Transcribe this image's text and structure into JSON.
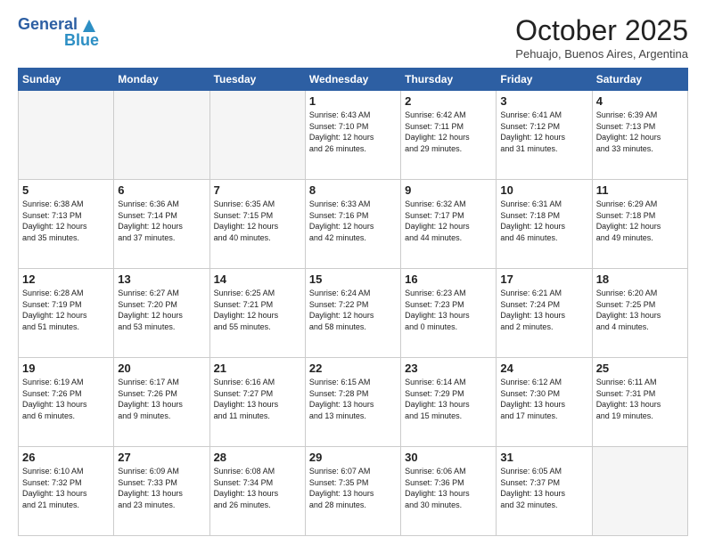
{
  "header": {
    "logo_line1": "General",
    "logo_line2": "Blue",
    "month_title": "October 2025",
    "location": "Pehuajo, Buenos Aires, Argentina"
  },
  "days_of_week": [
    "Sunday",
    "Monday",
    "Tuesday",
    "Wednesday",
    "Thursday",
    "Friday",
    "Saturday"
  ],
  "weeks": [
    [
      {
        "num": "",
        "info": ""
      },
      {
        "num": "",
        "info": ""
      },
      {
        "num": "",
        "info": ""
      },
      {
        "num": "1",
        "info": "Sunrise: 6:43 AM\nSunset: 7:10 PM\nDaylight: 12 hours\nand 26 minutes."
      },
      {
        "num": "2",
        "info": "Sunrise: 6:42 AM\nSunset: 7:11 PM\nDaylight: 12 hours\nand 29 minutes."
      },
      {
        "num": "3",
        "info": "Sunrise: 6:41 AM\nSunset: 7:12 PM\nDaylight: 12 hours\nand 31 minutes."
      },
      {
        "num": "4",
        "info": "Sunrise: 6:39 AM\nSunset: 7:13 PM\nDaylight: 12 hours\nand 33 minutes."
      }
    ],
    [
      {
        "num": "5",
        "info": "Sunrise: 6:38 AM\nSunset: 7:13 PM\nDaylight: 12 hours\nand 35 minutes."
      },
      {
        "num": "6",
        "info": "Sunrise: 6:36 AM\nSunset: 7:14 PM\nDaylight: 12 hours\nand 37 minutes."
      },
      {
        "num": "7",
        "info": "Sunrise: 6:35 AM\nSunset: 7:15 PM\nDaylight: 12 hours\nand 40 minutes."
      },
      {
        "num": "8",
        "info": "Sunrise: 6:33 AM\nSunset: 7:16 PM\nDaylight: 12 hours\nand 42 minutes."
      },
      {
        "num": "9",
        "info": "Sunrise: 6:32 AM\nSunset: 7:17 PM\nDaylight: 12 hours\nand 44 minutes."
      },
      {
        "num": "10",
        "info": "Sunrise: 6:31 AM\nSunset: 7:18 PM\nDaylight: 12 hours\nand 46 minutes."
      },
      {
        "num": "11",
        "info": "Sunrise: 6:29 AM\nSunset: 7:18 PM\nDaylight: 12 hours\nand 49 minutes."
      }
    ],
    [
      {
        "num": "12",
        "info": "Sunrise: 6:28 AM\nSunset: 7:19 PM\nDaylight: 12 hours\nand 51 minutes."
      },
      {
        "num": "13",
        "info": "Sunrise: 6:27 AM\nSunset: 7:20 PM\nDaylight: 12 hours\nand 53 minutes."
      },
      {
        "num": "14",
        "info": "Sunrise: 6:25 AM\nSunset: 7:21 PM\nDaylight: 12 hours\nand 55 minutes."
      },
      {
        "num": "15",
        "info": "Sunrise: 6:24 AM\nSunset: 7:22 PM\nDaylight: 12 hours\nand 58 minutes."
      },
      {
        "num": "16",
        "info": "Sunrise: 6:23 AM\nSunset: 7:23 PM\nDaylight: 13 hours\nand 0 minutes."
      },
      {
        "num": "17",
        "info": "Sunrise: 6:21 AM\nSunset: 7:24 PM\nDaylight: 13 hours\nand 2 minutes."
      },
      {
        "num": "18",
        "info": "Sunrise: 6:20 AM\nSunset: 7:25 PM\nDaylight: 13 hours\nand 4 minutes."
      }
    ],
    [
      {
        "num": "19",
        "info": "Sunrise: 6:19 AM\nSunset: 7:26 PM\nDaylight: 13 hours\nand 6 minutes."
      },
      {
        "num": "20",
        "info": "Sunrise: 6:17 AM\nSunset: 7:26 PM\nDaylight: 13 hours\nand 9 minutes."
      },
      {
        "num": "21",
        "info": "Sunrise: 6:16 AM\nSunset: 7:27 PM\nDaylight: 13 hours\nand 11 minutes."
      },
      {
        "num": "22",
        "info": "Sunrise: 6:15 AM\nSunset: 7:28 PM\nDaylight: 13 hours\nand 13 minutes."
      },
      {
        "num": "23",
        "info": "Sunrise: 6:14 AM\nSunset: 7:29 PM\nDaylight: 13 hours\nand 15 minutes."
      },
      {
        "num": "24",
        "info": "Sunrise: 6:12 AM\nSunset: 7:30 PM\nDaylight: 13 hours\nand 17 minutes."
      },
      {
        "num": "25",
        "info": "Sunrise: 6:11 AM\nSunset: 7:31 PM\nDaylight: 13 hours\nand 19 minutes."
      }
    ],
    [
      {
        "num": "26",
        "info": "Sunrise: 6:10 AM\nSunset: 7:32 PM\nDaylight: 13 hours\nand 21 minutes."
      },
      {
        "num": "27",
        "info": "Sunrise: 6:09 AM\nSunset: 7:33 PM\nDaylight: 13 hours\nand 23 minutes."
      },
      {
        "num": "28",
        "info": "Sunrise: 6:08 AM\nSunset: 7:34 PM\nDaylight: 13 hours\nand 26 minutes."
      },
      {
        "num": "29",
        "info": "Sunrise: 6:07 AM\nSunset: 7:35 PM\nDaylight: 13 hours\nand 28 minutes."
      },
      {
        "num": "30",
        "info": "Sunrise: 6:06 AM\nSunset: 7:36 PM\nDaylight: 13 hours\nand 30 minutes."
      },
      {
        "num": "31",
        "info": "Sunrise: 6:05 AM\nSunset: 7:37 PM\nDaylight: 13 hours\nand 32 minutes."
      },
      {
        "num": "",
        "info": ""
      }
    ]
  ]
}
